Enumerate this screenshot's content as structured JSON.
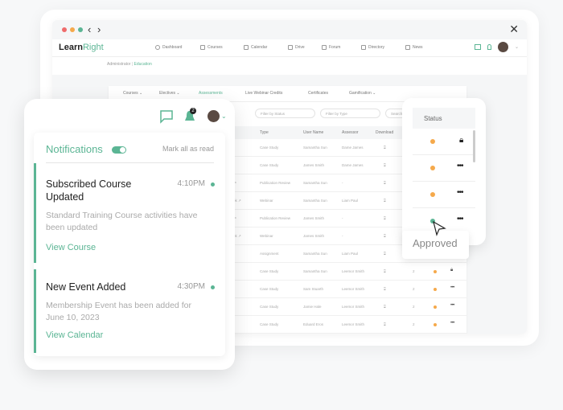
{
  "window": {
    "close": "✕",
    "back": "‹",
    "forward": "›"
  },
  "app": {
    "brand_a": "Learn",
    "brand_b": "Right",
    "nav": [
      {
        "label": "Dashboard",
        "icon": "dashboard-icon"
      },
      {
        "label": "Courses",
        "icon": "courses-icon"
      },
      {
        "label": "Calendar",
        "icon": "calendar-icon"
      },
      {
        "label": "Drive",
        "icon": "drive-icon"
      },
      {
        "label": "Forum",
        "icon": "forum-icon"
      },
      {
        "label": "Directory",
        "icon": "directory-icon"
      },
      {
        "label": "News",
        "icon": "news-icon"
      }
    ],
    "breadcrumb": {
      "role": "Administrator",
      "separator": " | ",
      "section": "Education"
    }
  },
  "tabs": [
    "Courses ⌄",
    "Electives ⌄",
    "Assessments",
    "Live Webinar Credits",
    "Certificates",
    "Gamification ⌄"
  ],
  "filters": {
    "status": "Filter by Status",
    "type": "Filter by Type",
    "search": "Search by User"
  },
  "table": {
    "headers": [
      "Type",
      "User Name",
      "Assessor",
      "Download"
    ],
    "rows": [
      {
        "prefix": "",
        "type": "Case Study",
        "user": "Samantha Sun",
        "assessor": "Dame James"
      },
      {
        "prefix": "",
        "type": "Case Study",
        "user": "James Smith",
        "assessor": "Dame James"
      },
      {
        "prefix": "ur ↗",
        "type": "Publication Review",
        "user": "Samantha Sun",
        "assessor": "-"
      },
      {
        "prefix": "book ↗",
        "type": "Webinar",
        "user": "Samantha Sun",
        "assessor": "Liam Paul"
      },
      {
        "prefix": "ur ↗",
        "type": "Publication Review",
        "user": "James Smith",
        "assessor": "-"
      },
      {
        "prefix": "book ↗",
        "type": "Webinar",
        "user": "James Smith",
        "assessor": "-"
      },
      {
        "prefix": "e ↗",
        "type": "Assignment",
        "user": "Samantha Sun",
        "assessor": "Liam Paul"
      },
      {
        "prefix": "",
        "type": "Case Study",
        "user": "Samantha Sun",
        "assessor": "Leemor Smith",
        "count": "2",
        "action": "lock"
      },
      {
        "prefix": "",
        "type": "Case Study",
        "user": "Sam Stuarth",
        "assessor": "Leemor Smith",
        "count": "2",
        "action": "more"
      },
      {
        "prefix": "",
        "type": "Case Study",
        "user": "Jamie Hale",
        "assessor": "Leemor Smith",
        "count": "2",
        "action": "more"
      },
      {
        "prefix": "",
        "type": "Case Study",
        "user": "Eduard Eros",
        "assessor": "Leemor Smith",
        "count": "2",
        "action": "more"
      }
    ]
  },
  "status_card": {
    "header": "Status",
    "tooltip": "Approved",
    "rows": [
      {
        "status": "pending",
        "action": "lock"
      },
      {
        "status": "pending",
        "action": "more"
      },
      {
        "status": "pending",
        "action": "more"
      },
      {
        "status": "approved",
        "action": "more"
      }
    ]
  },
  "colors": {
    "accent": "#5bb594",
    "pending": "#f5a94b"
  },
  "notifications": {
    "badge": "2",
    "title": "Notifications",
    "mark_all": "Mark all as read",
    "items": [
      {
        "title": "Subscribed Course Updated",
        "time": "4:10PM",
        "desc": "Standard Training Course activities have been updated",
        "link": "View Course"
      },
      {
        "title": "New Event Added",
        "time": "4:30PM",
        "desc": "Membership Event has been added for June 10, 2023",
        "link": "View Calendar"
      }
    ]
  }
}
